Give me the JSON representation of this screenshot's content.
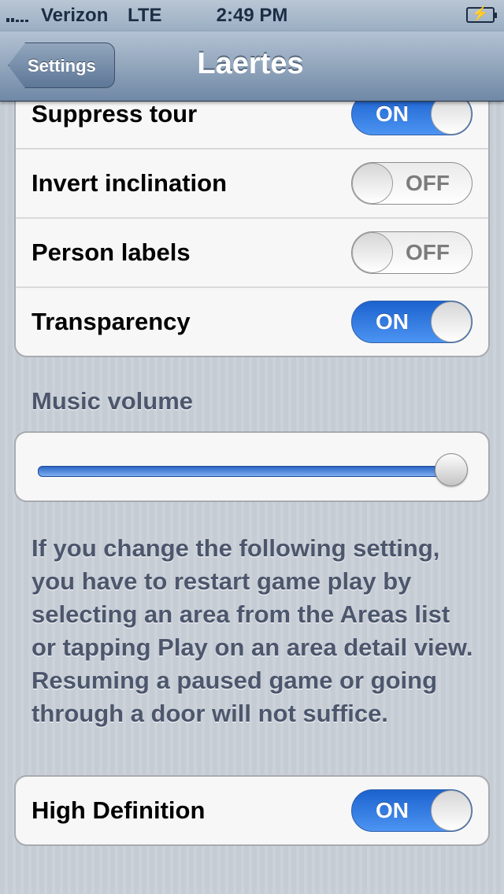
{
  "status_bar": {
    "carrier": "Verizon",
    "network": "LTE",
    "time": "2:49 PM",
    "battery_icon": "battery-charging-icon"
  },
  "nav": {
    "back_label": "Settings",
    "title": "Laertes"
  },
  "toggles_group": [
    {
      "label": "Suppress tour",
      "state": "ON"
    },
    {
      "label": "Invert inclination",
      "state": "OFF"
    },
    {
      "label": "Person labels",
      "state": "OFF"
    },
    {
      "label": "Transparency",
      "state": "ON"
    }
  ],
  "music": {
    "header": "Music volume",
    "volume_fraction": 1.0
  },
  "footnote": "If you change the following setting, you have to restart game play by selecting an area from the Areas list or tapping Play on an area detail view. Resuming a paused game or going through a door will not suffice.",
  "hd_group": [
    {
      "label": "High Definition",
      "state": "ON"
    }
  ],
  "colors": {
    "switch_on": "#2f7be0",
    "header_text": "#4c566c",
    "navbar": "#7990ab"
  }
}
